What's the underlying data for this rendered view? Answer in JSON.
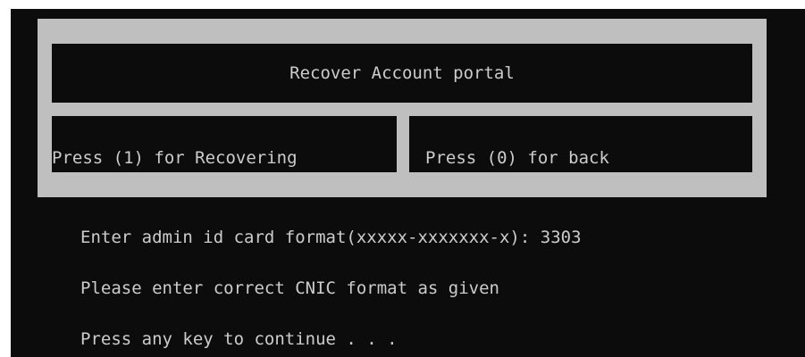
{
  "menu": {
    "title": "Recover Account portal",
    "option_recover": "Press (1) for Recovering",
    "option_back": "Press (0) for back"
  },
  "output": {
    "prompt": "Enter admin id card format(xxxxx-xxxxxxx-x): 3303",
    "error": "Please enter correct CNIC format as given",
    "continue": "Press any key to continue . . ."
  },
  "colors": {
    "console_background": "#0c0c0c",
    "console_text": "#cccccc",
    "menu_frame": "#bfbfbf"
  }
}
